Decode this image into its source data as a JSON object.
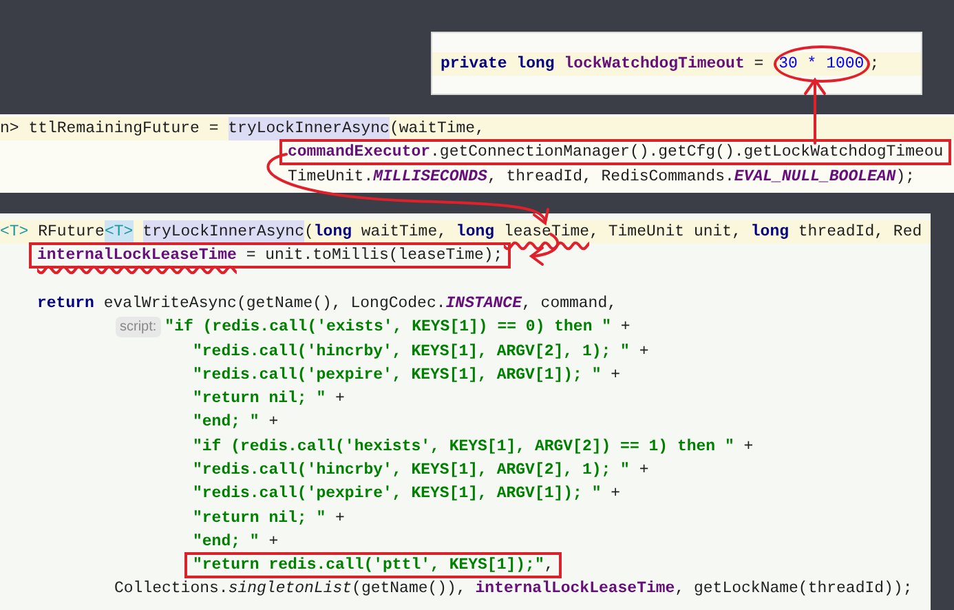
{
  "panels": [
    {
      "kind": "field",
      "lines": [
        {
          "kind": "field",
          "current": true,
          "tokens": [
            {
              "kind": "keyword",
              "text": "private long"
            },
            {
              "kind": "field",
              "text": " lockWatchdogTimeout"
            },
            {
              "kind": "plain",
              "text": " = "
            },
            {
              "kind": "number",
              "text": "30 * 1000",
              "circled": true
            },
            {
              "kind": "plain",
              "text": ";"
            }
          ]
        }
      ]
    },
    {
      "kind": "call",
      "lines": [
        {
          "kind": "top",
          "current": true,
          "tokens": [
            {
              "kind": "plain",
              "text": "n> ttlRemainingFuture = "
            },
            {
              "kind": "method",
              "text": "tryLockInnerAsync"
            },
            {
              "kind": "plain",
              "text": "(waitTime,"
            }
          ]
        },
        {
          "kind": "arg",
          "current": false,
          "boxed": true,
          "tokens": [
            {
              "kind": "field",
              "text": "commandExecutor"
            },
            {
              "kind": "plain",
              "text": ".getConnectionManager().getCfg().getLockWatchdogTimeou"
            }
          ]
        },
        {
          "kind": "arg",
          "current": false,
          "tokens": [
            {
              "kind": "plain",
              "text": "TimeUnit."
            },
            {
              "kind": "static",
              "text": "MILLISECONDS"
            },
            {
              "kind": "plain",
              "text": ", threadId, RedisCommands."
            },
            {
              "kind": "static",
              "text": "EVAL_NULL_BOOLEAN"
            },
            {
              "kind": "plain",
              "text": ");"
            }
          ]
        }
      ]
    },
    {
      "kind": "method",
      "lines": [
        {
          "kind": "top",
          "current": true,
          "tokens": [
            {
              "kind": "type_param",
              "text": "<T>"
            },
            {
              "kind": "plain",
              "text": " RFuture"
            },
            {
              "kind": "type_param_marked",
              "text": "<T>"
            },
            {
              "kind": "method",
              "text": "tryLockInnerAsync",
              "spaced": true
            },
            {
              "kind": "plain",
              "text": "("
            },
            {
              "kind": "keyword",
              "text": "long"
            },
            {
              "kind": "plain",
              "text": " waitTime, "
            },
            {
              "kind": "keyword",
              "text": "long "
            },
            {
              "kind": "plain",
              "text": "leaseTime",
              "underlined": true
            },
            {
              "kind": "plain",
              "text": ", TimeUnit unit, "
            },
            {
              "kind": "keyword",
              "text": "long"
            },
            {
              "kind": "plain",
              "text": " threadId, Red"
            }
          ]
        },
        {
          "kind": "body",
          "current": false,
          "boxed": true,
          "tokens": [
            {
              "kind": "field",
              "text": "internalLockLeaseTime",
              "underlined": true
            },
            {
              "kind": "plain",
              "text": " = unit.toMillis(leaseTime);"
            }
          ]
        },
        {
          "kind": "blank",
          "current": false
        },
        {
          "kind": "body",
          "current": false,
          "tokens": [
            {
              "kind": "keyword",
              "text": "return"
            },
            {
              "kind": "plain",
              "text": " evalWriteAsync(getName(), LongCodec."
            },
            {
              "kind": "static",
              "text": "INSTANCE"
            },
            {
              "kind": "plain",
              "text": ", command,"
            }
          ]
        },
        {
          "kind": "script",
          "current": false,
          "tokens": [
            {
              "kind": "hint",
              "text": "script:"
            },
            {
              "kind": "string",
              "text": "\"if (redis.call('exists', KEYS[1]) == 0) then \""
            },
            {
              "kind": "plain",
              "text": " +"
            }
          ]
        },
        {
          "kind": "string",
          "current": false,
          "tokens": [
            {
              "kind": "string",
              "text": "\"redis.call('hincrby', KEYS[1], ARGV[2], 1); \""
            },
            {
              "kind": "plain",
              "text": " +"
            }
          ]
        },
        {
          "kind": "string",
          "current": false,
          "tokens": [
            {
              "kind": "string",
              "text": "\"redis.call('pexpire', KEYS[1], ARGV[1]); \""
            },
            {
              "kind": "plain",
              "text": " +"
            }
          ]
        },
        {
          "kind": "string",
          "current": false,
          "tokens": [
            {
              "kind": "string",
              "text": "\"return nil; \""
            },
            {
              "kind": "plain",
              "text": " +"
            }
          ]
        },
        {
          "kind": "string",
          "current": false,
          "tokens": [
            {
              "kind": "string",
              "text": "\"end; \""
            },
            {
              "kind": "plain",
              "text": " +"
            }
          ]
        },
        {
          "kind": "string",
          "current": false,
          "tokens": [
            {
              "kind": "string",
              "text": "\"if (redis.call('hexists', KEYS[1], ARGV[2]) == 1) then \""
            },
            {
              "kind": "plain",
              "text": " +"
            }
          ]
        },
        {
          "kind": "string",
          "current": false,
          "tokens": [
            {
              "kind": "string",
              "text": "\"redis.call('hincrby', KEYS[1], ARGV[2], 1); \""
            },
            {
              "kind": "plain",
              "text": " +"
            }
          ]
        },
        {
          "kind": "string",
          "current": false,
          "tokens": [
            {
              "kind": "string",
              "text": "\"redis.call('pexpire', KEYS[1], ARGV[1]); \""
            },
            {
              "kind": "plain",
              "text": " +"
            }
          ]
        },
        {
          "kind": "string",
          "current": false,
          "tokens": [
            {
              "kind": "string",
              "text": "\"return nil; \""
            },
            {
              "kind": "plain",
              "text": " +"
            }
          ]
        },
        {
          "kind": "string",
          "current": false,
          "tokens": [
            {
              "kind": "string",
              "text": "\"end; \""
            },
            {
              "kind": "plain",
              "text": " +"
            }
          ]
        },
        {
          "kind": "string",
          "current": false,
          "boxed": true,
          "tokens": [
            {
              "kind": "string",
              "text": "\"return redis.call('pttl', KEYS[1]);\""
            },
            {
              "kind": "plain",
              "text": ","
            }
          ]
        },
        {
          "kind": "args",
          "current": false,
          "tokens": [
            {
              "kind": "plain",
              "text": "Collections."
            },
            {
              "kind": "static_method",
              "text": "singletonList"
            },
            {
              "kind": "plain",
              "text": "(getName()), "
            },
            {
              "kind": "field",
              "text": "internalLockLeaseTime"
            },
            {
              "kind": "plain",
              "text": ", getLockName(threadId));"
            }
          ]
        }
      ]
    }
  ]
}
